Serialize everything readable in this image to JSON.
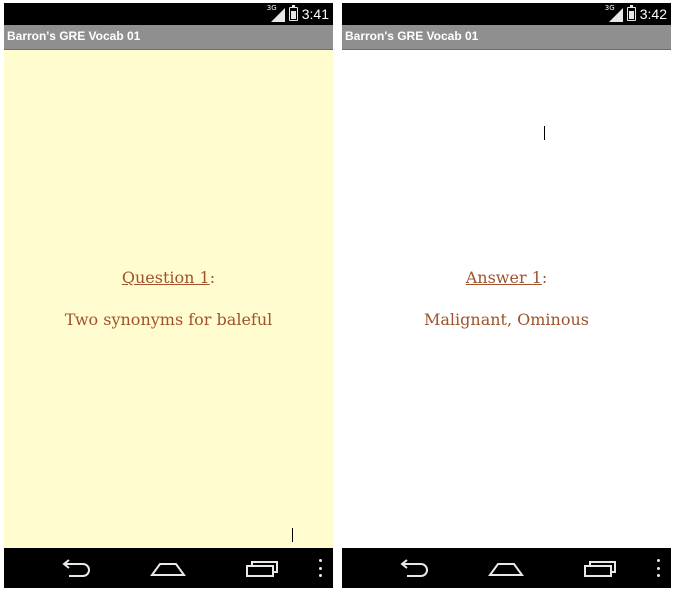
{
  "screens": [
    {
      "status": {
        "time": "3:41",
        "network": "3G"
      },
      "app_title": "Barron's GRE Vocab 01",
      "card": {
        "heading_word": "Question 1",
        "heading_suffix": ":",
        "body": "Two synonyms for baleful",
        "background": "#fffccf"
      }
    },
    {
      "status": {
        "time": "3:42",
        "network": "3G"
      },
      "app_title": "Barron's GRE Vocab 01",
      "card": {
        "heading_word": "Answer 1",
        "heading_suffix": ":",
        "body": "Malignant, Ominous",
        "background": "#ffffff"
      }
    }
  ],
  "colors": {
    "text": "#a0522d",
    "titlebar": "#8f8f8f",
    "system_bars": "#000000"
  },
  "icons": {
    "back": "back-icon",
    "home": "home-icon",
    "recents": "recents-icon",
    "menu": "overflow-menu-icon"
  }
}
